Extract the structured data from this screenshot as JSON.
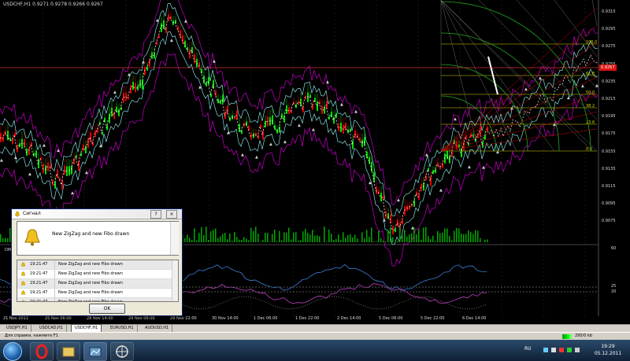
{
  "chart": {
    "title": "USDCHF,H1  0.9271 0.9278 0.9266 0.9267",
    "current_price": "0.9267",
    "price_ticks": [
      "0.9315",
      "0.9295",
      "0.9275",
      "0.9255",
      "0.9235",
      "0.9215",
      "0.9195",
      "0.9175",
      "0.9155",
      "0.9135",
      "0.9115",
      "0.9095",
      "0.9075"
    ],
    "time_ticks": [
      "21 Nov 2011",
      "25 Nov 06:00",
      "28 Nov 14:00",
      "29 Nov 06:00",
      "29 Nov 22:00",
      "30 Nov 14:00",
      "1 Dec 06:00",
      "1 Dec 22:00",
      "2 Dec 14:00",
      "5 Dec 06:00",
      "5 Dec 22:00",
      "6 Dec 14:00"
    ],
    "fibo_levels": [
      "100.0",
      "61.8",
      "50.0",
      "38.2",
      "23.6",
      "0.0"
    ],
    "subwindow_label": "DM",
    "subwindow_ticks": [
      "60",
      "25",
      "20"
    ],
    "colors": {
      "bull": "#00e000",
      "bear": "#e00000",
      "bands": "#b000b0",
      "fibo": "#d8d800",
      "grid": "#333333"
    }
  },
  "tabs": [
    "USDJPY,H1",
    "USDCAD,H1",
    "USDCHF,H1",
    "EURUSD,H1",
    "AUDUSD,H1"
  ],
  "active_tab": "USDCHF,H1",
  "status": {
    "help_text": "Для справки, нажмите F1",
    "traffic": "295/0 kb"
  },
  "dialog": {
    "title": "Сигнал",
    "help_button": "?",
    "close_button": "×",
    "message": "New ZigZag and new Fibo drawn",
    "log": [
      {
        "time": "19:21:47",
        "text": "New ZigZag and new Fibo drawn"
      },
      {
        "time": "19:21:47",
        "text": "New ZigZag and new Fibo drawn"
      },
      {
        "time": "19:21:47",
        "text": "New ZigZag and new Fibo drawn"
      },
      {
        "time": "19:21:47",
        "text": "New ZigZag and new Fibo drawn"
      },
      {
        "time": "19:21:47",
        "text": "New ZigZag and new Fibo drawn"
      }
    ],
    "ok_label": "OK"
  },
  "taskbar": {
    "lang": "RU",
    "time": "19:29",
    "date": "05.12.2011"
  }
}
